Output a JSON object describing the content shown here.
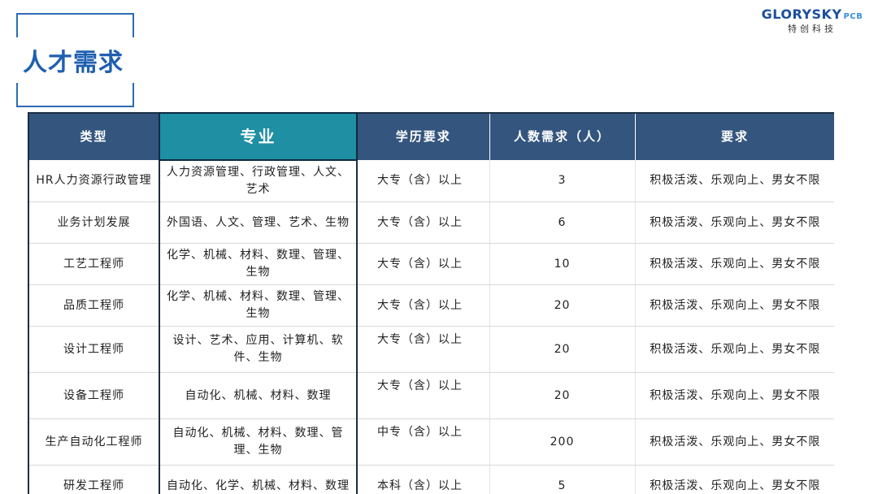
{
  "header": {
    "title": "人才需求",
    "logo_main": "GLORYSKY",
    "logo_suffix": "PCB",
    "logo_sub": "特创科技"
  },
  "table": {
    "columns": [
      "类型",
      "专业",
      "学历要求",
      "人数需求（人）",
      "要求"
    ],
    "rows": [
      {
        "type": "HR人力资源行政管理",
        "major": "人力资源管理、行政管理、人文、艺术",
        "edu": "大专（含）以上",
        "count": "3",
        "req": "积极活泼、乐观向上、男女不限"
      },
      {
        "type": "业务计划发展",
        "major": "外国语、人文、管理、艺术、生物",
        "edu": "大专（含）以上",
        "count": "6",
        "req": "积极活泼、乐观向上、男女不限"
      },
      {
        "type": "工艺工程师",
        "major": "化学、机械、材料、数理、管理、生物",
        "edu": "大专（含）以上",
        "count": "10",
        "req": "积极活泼、乐观向上、男女不限"
      },
      {
        "type": "品质工程师",
        "major": "化学、机械、材料、数理、管理、生物",
        "edu": "大专（含）以上",
        "count": "20",
        "req": "积极活泼、乐观向上、男女不限"
      },
      {
        "type": "设计工程师",
        "major": "设计、艺术、应用、计算机、软件、生物",
        "edu": "大专（含）以上",
        "count": "20",
        "req": "积极活泼、乐观向上、男女不限"
      },
      {
        "type": "设备工程师",
        "major": "自动化、机械、材料、数理",
        "edu": "大专（含）以上",
        "count": "20",
        "req": "积极活泼、乐观向上、男女不限"
      },
      {
        "type": "生产自动化工程师",
        "major": "自动化、机械、材料、数理、管理、生物",
        "edu": "中专（含）以上",
        "count": "200",
        "req": "积极活泼、乐观向上、男女不限"
      },
      {
        "type": "研发工程师",
        "major": "自动化、化学、机械、材料、数理",
        "edu": "本科（含）以上",
        "count": "5",
        "req": "积极活泼、乐观向上、男女不限"
      }
    ]
  },
  "colors": {
    "header_bg": "#34557e",
    "major_header_bg": "#1f8fa3",
    "title_blue": "#1f5fb0"
  }
}
